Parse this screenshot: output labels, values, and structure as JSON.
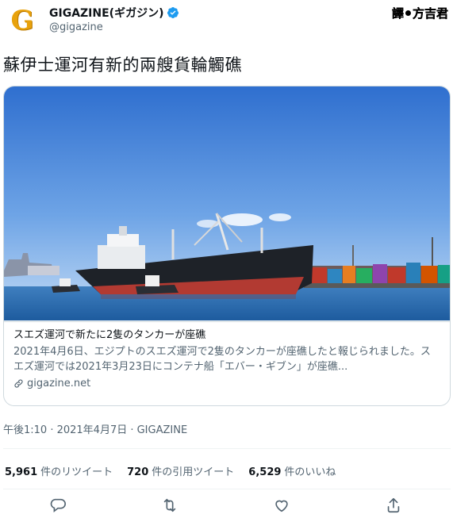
{
  "account": {
    "display_name": "GIGAZINE(ギガジン)",
    "handle": "@gigazine",
    "avatar_letter": "G"
  },
  "translator": {
    "left": "譯",
    "right": "方吉君"
  },
  "tweet": {
    "text": "蘇伊士運河有新的兩艘貨輪觸礁"
  },
  "card": {
    "title": "スエズ運河で新たに2隻のタンカーが座礁",
    "description": "2021年4月6日、エジプトのスエズ運河で2隻のタンカーが座礁したと報じられました。スエズ運河では2021年3月23日にコンテナ船「エバー・ギブン」が座礁...",
    "domain": "gigazine.net"
  },
  "timestamp": "午後1:10 · 2021年4月7日 · GIGAZINE",
  "stats": {
    "retweets": {
      "count": "5,961",
      "label": "件のリツイート"
    },
    "quotes": {
      "count": "720",
      "label": "件の引用ツイート"
    },
    "likes": {
      "count": "6,529",
      "label": "件のいいね"
    }
  },
  "colors": {
    "verified": "#1d9bf0",
    "text_secondary": "#536471",
    "avatar": "#e8a20c"
  }
}
